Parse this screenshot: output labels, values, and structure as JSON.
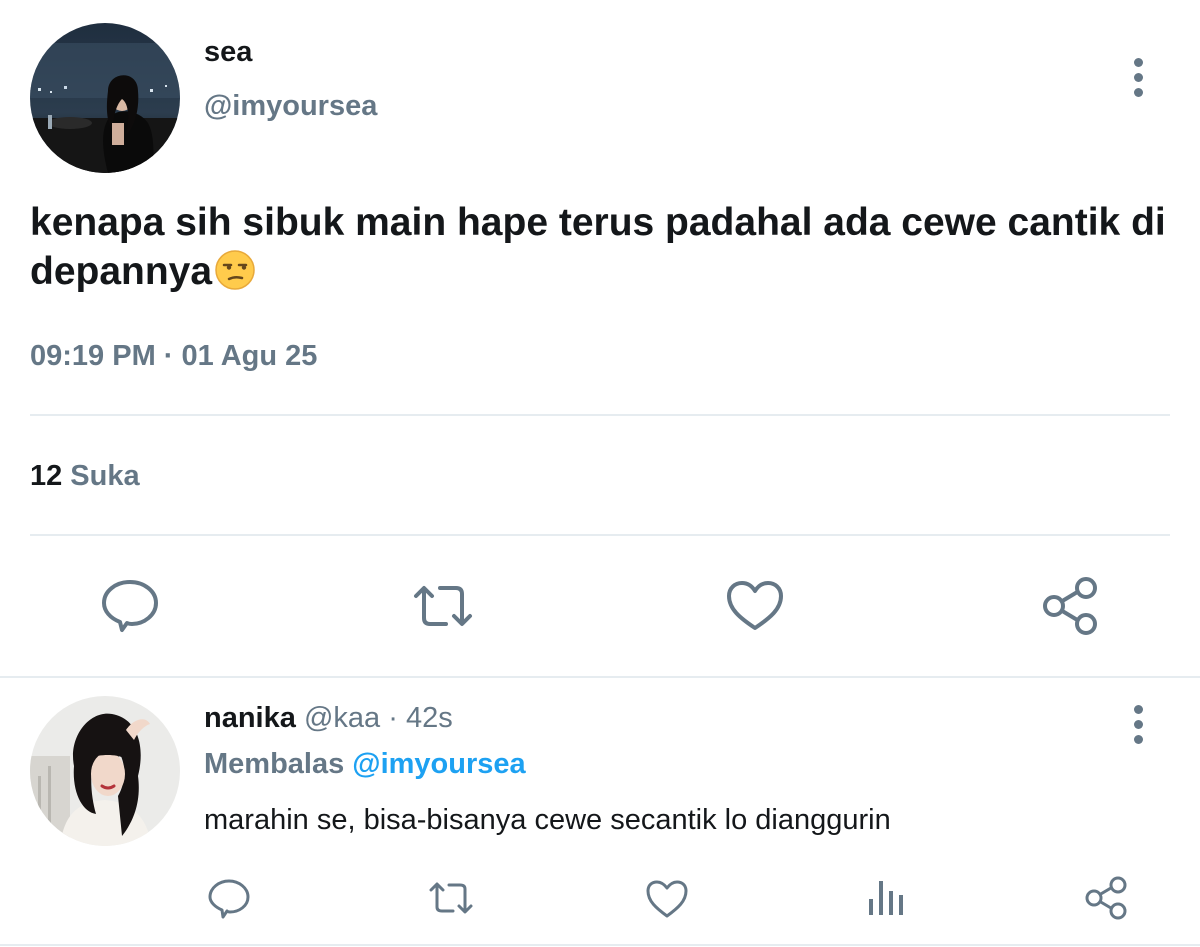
{
  "tweet": {
    "name": "sea",
    "handle": "@imyoursea",
    "text": "kenapa sih sibuk main hape terus padahal ada cewe cantik di depannya",
    "emoji": "unamused-face",
    "timestamp": "09:19 PM · 01 Agu 25",
    "likes_count": "12",
    "likes_label": "Suka",
    "actions": [
      "reply-icon",
      "retweet-icon",
      "heart-icon",
      "share-icon"
    ]
  },
  "reply": {
    "name": "nanika",
    "handle": "@kaa",
    "separator": "·",
    "time": "42s",
    "replying_label": "Membalas",
    "replying_to": "@imyoursea",
    "text": "marahin se, bisa-bisanya cewe secantik lo dianggurin",
    "actions": [
      "reply-icon",
      "retweet-icon",
      "heart-icon",
      "analytics-icon",
      "share-icon"
    ]
  },
  "colors": {
    "text": "#14171a",
    "secondary": "#657786",
    "accent": "#1da1f2",
    "divider": "#e6ecf0"
  }
}
